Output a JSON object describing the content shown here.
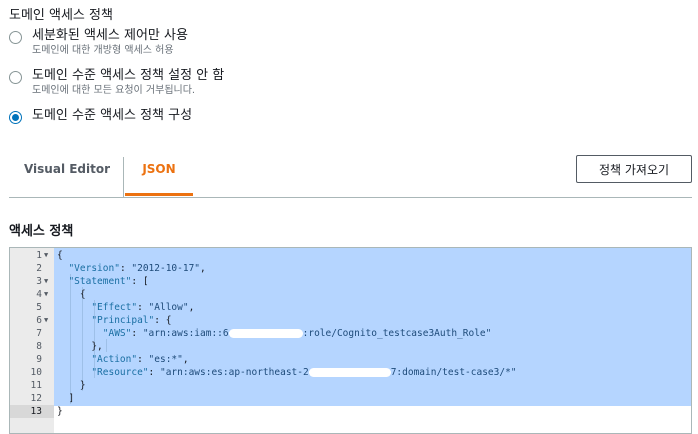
{
  "section_title": "도메인 액세스 정책",
  "radios": [
    {
      "label": "세분화된 액세스 제어만 사용",
      "desc": "도메인에 대한 개방형 액세스 허용",
      "checked": false
    },
    {
      "label": "도메인 수준 액세스 정책 설정 안 함",
      "desc": "도메인에 대한 모든 요청이 거부됩니다.",
      "checked": false
    },
    {
      "label": "도메인 수준 액세스 정책 구성",
      "desc": "",
      "checked": true
    }
  ],
  "tabs": {
    "visual": "Visual Editor",
    "json": "JSON",
    "active": "json"
  },
  "import_button": "정책 가져오기",
  "policy_label": "액세스 정책",
  "editor": {
    "line_numbers": [
      "1",
      "2",
      "3",
      "4",
      "5",
      "6",
      "7",
      "8",
      "9",
      "10",
      "11",
      "12",
      "13"
    ],
    "active_line": "13",
    "tokens": {
      "l1": "{",
      "l2k": "\"Version\"",
      "l2v": "\"2012-10-17\"",
      "l3k": "\"Statement\"",
      "l3v": "[",
      "l4": "{",
      "l5k": "\"Effect\"",
      "l5v": "\"Allow\"",
      "l6k": "\"Principal\"",
      "l6v": "{",
      "l7k": "\"AWS\"",
      "l7a": "\"arn:aws:iam::6",
      "l7b": ":role/Cognito_testcase3Auth_Role\"",
      "l8": "},",
      "l9k": "\"Action\"",
      "l9v": "\"es:*\"",
      "l10k": "\"Resource\"",
      "l10a": "\"arn:aws:es:ap-northeast-2",
      "l10b": "7:domain/test-case3/*\"",
      "l11": "}",
      "l12": "]",
      "l13": "}"
    }
  },
  "colors": {
    "accent": "#ec7211",
    "radio": "#0073bb",
    "selection": "#b5d5ff"
  }
}
